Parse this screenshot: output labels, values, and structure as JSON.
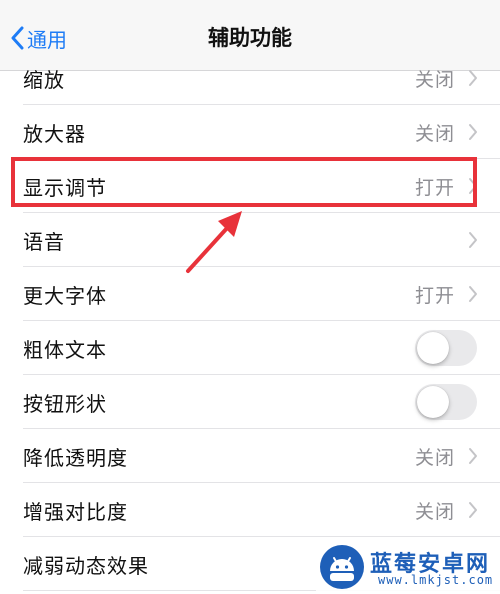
{
  "nav": {
    "back_label": "通用",
    "title": "辅助功能"
  },
  "rows": [
    {
      "label": "缩放",
      "value": "关闭",
      "control": "chevron"
    },
    {
      "label": "放大器",
      "value": "关闭",
      "control": "chevron"
    },
    {
      "label": "显示调节",
      "value": "打开",
      "control": "chevron",
      "highlighted": true
    },
    {
      "label": "语音",
      "value": "",
      "control": "chevron"
    },
    {
      "label": "更大字体",
      "value": "打开",
      "control": "chevron"
    },
    {
      "label": "粗体文本",
      "control": "toggle",
      "toggle_on": false
    },
    {
      "label": "按钮形状",
      "control": "toggle",
      "toggle_on": false
    },
    {
      "label": "降低透明度",
      "value": "关闭",
      "control": "chevron"
    },
    {
      "label": "增强对比度",
      "value": "关闭",
      "control": "chevron"
    },
    {
      "label": "减弱动态效果",
      "value": "",
      "control": "none"
    }
  ],
  "watermark": {
    "name": "蓝莓安卓网",
    "url": "www.lmkjst.com"
  },
  "colors": {
    "accent": "#1e7cf6",
    "highlight": "#e8323a",
    "secondary_text": "#8e8e93",
    "toggle_off": "#e9e9eb"
  }
}
